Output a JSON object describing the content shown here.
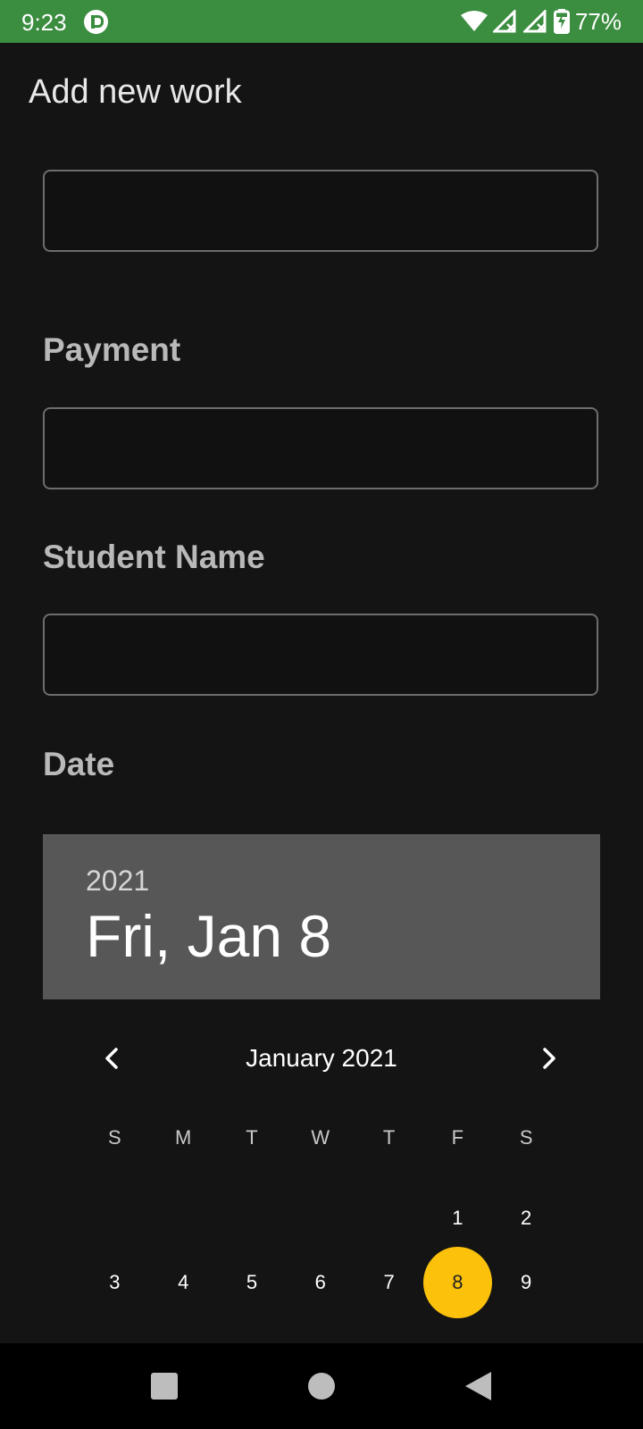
{
  "status_bar": {
    "time": "9:23",
    "battery": "77%",
    "icons": [
      "app-notification-icon",
      "wifi-icon",
      "signal-icon",
      "signal-icon",
      "battery-charging-icon"
    ],
    "color": "#3b8d3f"
  },
  "page": {
    "title": "Add new work"
  },
  "form": {
    "first_field_value": "",
    "payment_label": "Payment",
    "payment_value": "",
    "student_label": "Student Name",
    "student_value": "",
    "date_label": "Date"
  },
  "date_picker": {
    "year": "2021",
    "selected_display": "Fri, Jan 8",
    "month_label": "January 2021",
    "weekdays": [
      "S",
      "M",
      "T",
      "W",
      "T",
      "F",
      "S"
    ],
    "weeks": [
      [
        "",
        "",
        "",
        "",
        "",
        "1",
        "2"
      ],
      [
        "3",
        "4",
        "5",
        "6",
        "7",
        "8",
        "9"
      ]
    ],
    "selected_day": "8",
    "accent": "#fbc10b",
    "header_bg": "#575757"
  },
  "nav_bar": {
    "icons": [
      "recent-apps-icon",
      "home-icon",
      "back-icon"
    ]
  }
}
